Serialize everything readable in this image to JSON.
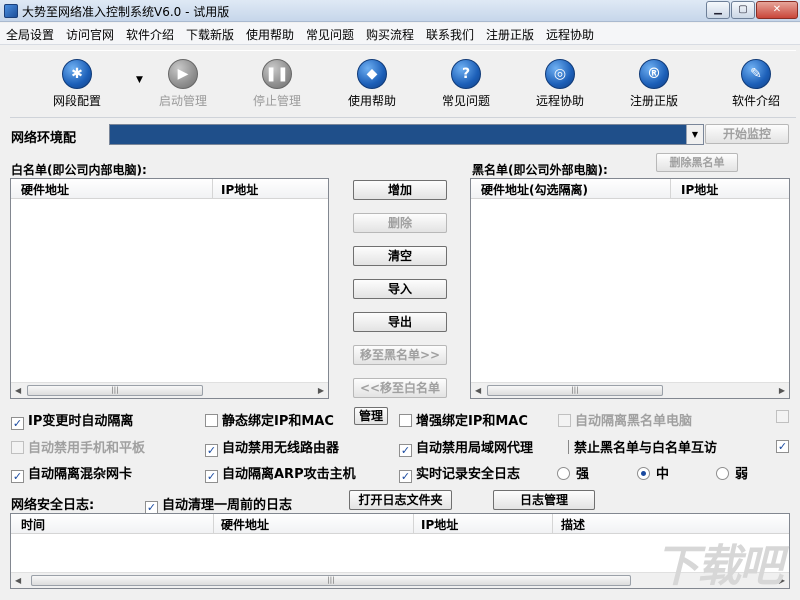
{
  "window": {
    "title": "大势至网络准入控制系统V6.0 - 试用版"
  },
  "menu": [
    "全局设置",
    "访问官网",
    "软件介绍",
    "下载新版",
    "使用帮助",
    "常见问题",
    "购买流程",
    "联系我们",
    "注册正版",
    "远程协助"
  ],
  "toolbar": {
    "items": [
      {
        "label": "网段配置",
        "icon": "gear-icon",
        "glyph": "✱"
      },
      {
        "label": "启动管理",
        "icon": "play-icon",
        "glyph": "▶"
      },
      {
        "label": "停止管理",
        "icon": "pause-icon",
        "glyph": "❚❚"
      },
      {
        "label": "使用帮助",
        "icon": "graduation-cap-icon",
        "glyph": "◆"
      },
      {
        "label": "常见问题",
        "icon": "question-icon",
        "glyph": "?"
      },
      {
        "label": "远程协助",
        "icon": "globe-icon",
        "glyph": "◎"
      },
      {
        "label": "注册正版",
        "icon": "registered-icon",
        "glyph": "®"
      },
      {
        "label": "软件介绍",
        "icon": "document-icon",
        "glyph": "✎"
      }
    ]
  },
  "network": {
    "label": "网络环境配",
    "selected": "",
    "start_monitor": "开始监控"
  },
  "whitelist": {
    "label": "白名单(即公司内部电脑):",
    "columns": [
      "硬件地址",
      "IP地址"
    ],
    "rows": []
  },
  "blacklist": {
    "label": "黑名单(即公司外部电脑):",
    "delete_btn": "删除黑名单",
    "columns": [
      "硬件地址(勾选隔离)",
      "IP地址"
    ],
    "rows": []
  },
  "actions": {
    "add": "增加",
    "delete": "删除",
    "clear": "清空",
    "import": "导入",
    "export": "导出",
    "to_blacklist": "移至黑名单>>",
    "to_whitelist": "<<移至白名单"
  },
  "options": {
    "ip_change_isolate": "IP变更时自动隔离",
    "static_bind": "静态绑定IP和MAC",
    "manage": "管理",
    "enhanced_bind": "增强绑定IP和MAC",
    "auto_isolate_blacklist": "自动隔离黑名单电脑",
    "auto_disable_mobile": "自动禁用手机和平板",
    "auto_disable_router": "自动禁用无线路由器",
    "auto_disable_proxy": "自动禁用局域网代理",
    "forbid_mutual": "禁止黑名单与白名单互访",
    "auto_isolate_promisc": "自动隔离混杂网卡",
    "auto_isolate_arp": "自动隔离ARP攻击主机",
    "realtime_log": "实时记录安全日志",
    "level_strong": "强",
    "level_medium": "中",
    "level_weak": "弱"
  },
  "log": {
    "label": "网络安全日志:",
    "auto_clean": "自动清理一周前的日志",
    "open_folder": "打开日志文件夹",
    "manage": "日志管理",
    "columns": [
      "时间",
      "硬件地址",
      "IP地址",
      "描述"
    ],
    "rows": []
  },
  "watermark": "下载吧"
}
